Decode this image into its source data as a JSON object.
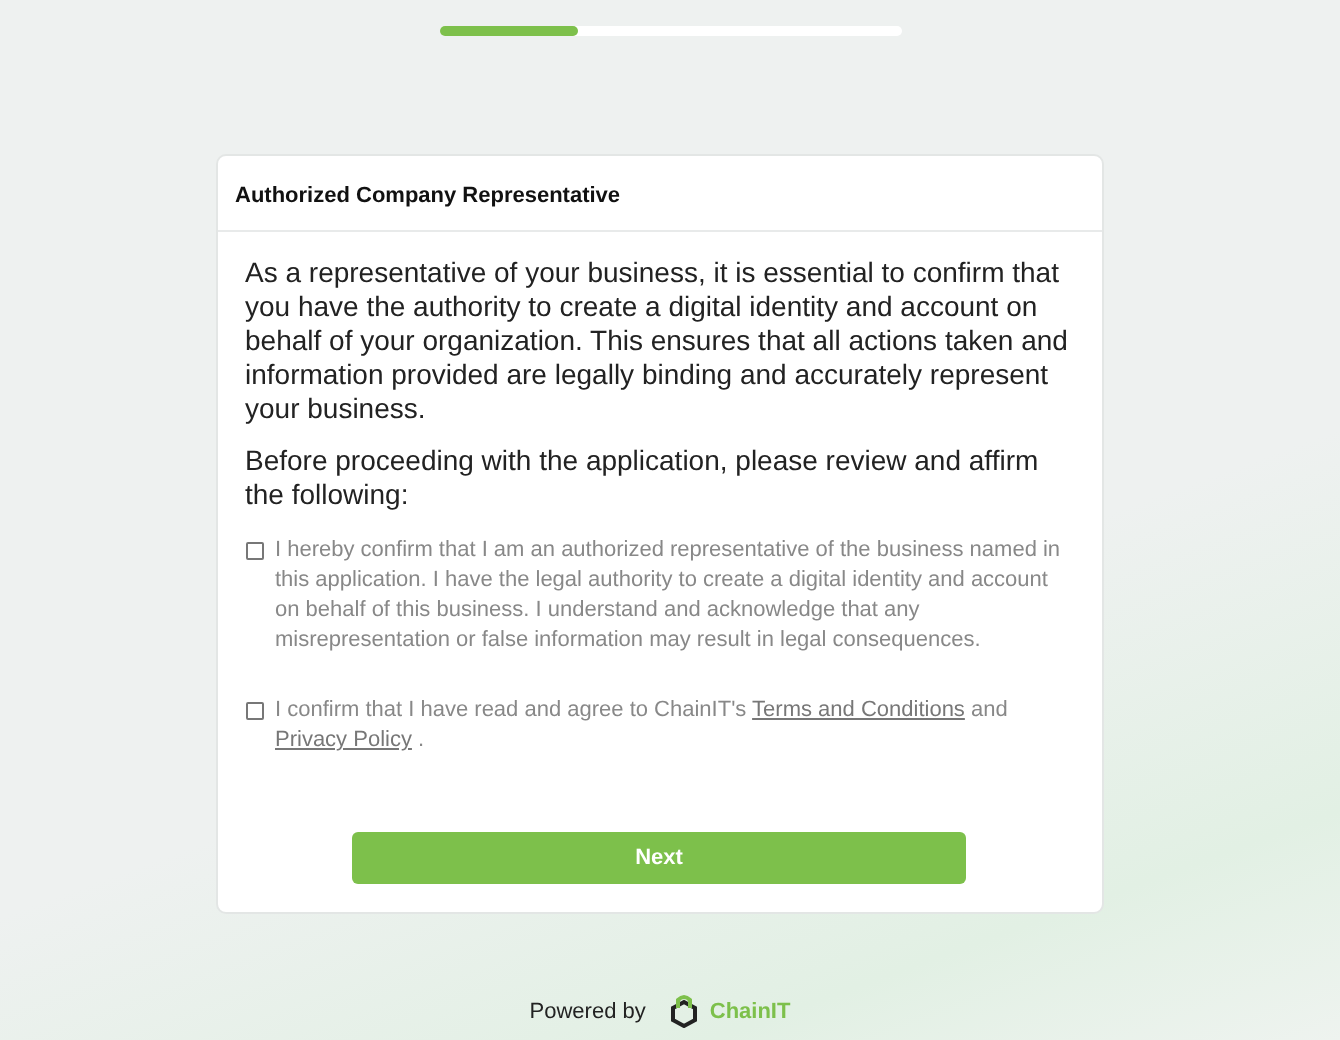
{
  "progress": {
    "level": 0.3
  },
  "card": {
    "title": "Authorized Company Representative",
    "intro": "As a representative of your business, it is essential to confirm that you have the authority to create a digital identity and account on behalf of your organization. This ensures that all actions taken and information provided are legally binding and accurately represent your business.",
    "prompt": "Before proceeding with the application, please review and affirm the following:",
    "agreements": [
      {
        "checked": false,
        "parts": [
          {
            "kind": "text",
            "text": "I hereby confirm that I am an authorized representative of the business named in this application. I have the legal authority to create a digital identity and account on behalf of this business. I understand and acknowledge that any misrepresentation or false information may result in legal consequences."
          }
        ]
      },
      {
        "checked": false,
        "parts": [
          {
            "kind": "text",
            "text": "I confirm that I have read and agree to ChainIT's"
          },
          {
            "kind": "link",
            "text": "Terms and Conditions"
          },
          {
            "kind": "text",
            "text": "and"
          },
          {
            "kind": "link",
            "text": "Privacy Policy"
          },
          {
            "kind": "text",
            "text": "."
          }
        ]
      }
    ],
    "button": "Next"
  },
  "footer": {
    "powered_by": "Powered by",
    "brand": "ChainIT"
  }
}
